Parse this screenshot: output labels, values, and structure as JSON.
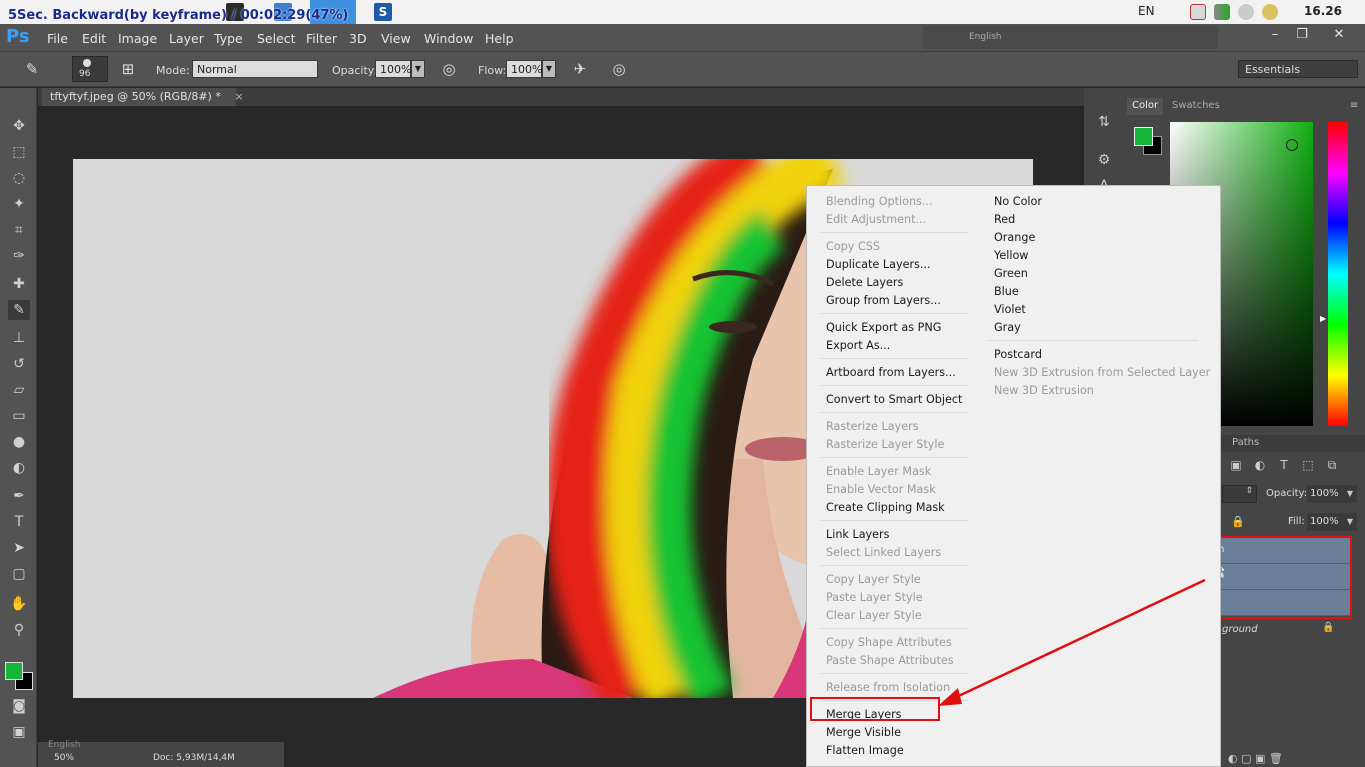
{
  "recording_overlay": "5Sec. Backward(by keyframe) / 00:02:29(47%)",
  "system_tray": {
    "language": "EN",
    "time": "16.26"
  },
  "menubar": {
    "logo": "Ps",
    "items": [
      "File",
      "Edit",
      "Image",
      "Layer",
      "Type",
      "Select",
      "Filter",
      "3D",
      "View",
      "Window",
      "Help"
    ],
    "workspace_lang": "English",
    "window_buttons": [
      "–",
      "❐",
      "✕"
    ]
  },
  "options": {
    "brush_size": "96",
    "mode_label": "Mode:",
    "mode_value": "Normal",
    "opacity_label": "Opacity:",
    "opacity_value": "100%",
    "flow_label": "Flow:",
    "flow_value": "100%",
    "workspace": "Essentials"
  },
  "document": {
    "tab_title": "tftyftyf.jpeg @ 50% (RGB/8#) *",
    "tab_close": "×",
    "zoom": "50%",
    "doc_info": "Doc: 5,93M/14,4M",
    "status_lang": "English"
  },
  "panels": {
    "color_tab": "Color",
    "swatches_tab": "Swatches",
    "paths_tab": "Paths",
    "opacity_label": "Opacity:",
    "opacity_value": "100%",
    "fill_label": "Fill:",
    "fill_value": "100%",
    "background_layer": "ground",
    "fg_color": "#16b43a",
    "bg_color": "#000000"
  },
  "layers": [
    {
      "name": "n"
    },
    {
      "name": "n"
    },
    {
      "name": ""
    }
  ],
  "context_menu": {
    "left_column": [
      {
        "label": "Blending Options...",
        "enabled": false
      },
      {
        "label": "Edit Adjustment...",
        "enabled": false
      },
      {
        "label": "Copy CSS",
        "enabled": false
      },
      {
        "label": "Duplicate Layers...",
        "enabled": true
      },
      {
        "label": "Delete Layers",
        "enabled": true
      },
      {
        "label": "Group from Layers...",
        "enabled": true
      },
      {
        "label": "Quick Export as PNG",
        "enabled": true
      },
      {
        "label": "Export As...",
        "enabled": true
      },
      {
        "label": "Artboard from Layers...",
        "enabled": true
      },
      {
        "label": "Convert to Smart Object",
        "enabled": true
      },
      {
        "label": "Rasterize Layers",
        "enabled": false
      },
      {
        "label": "Rasterize Layer Style",
        "enabled": false
      },
      {
        "label": "Enable Layer Mask",
        "enabled": false
      },
      {
        "label": "Enable Vector Mask",
        "enabled": false
      },
      {
        "label": "Create Clipping Mask",
        "enabled": true
      },
      {
        "label": "Link Layers",
        "enabled": true
      },
      {
        "label": "Select Linked Layers",
        "enabled": false
      },
      {
        "label": "Copy Layer Style",
        "enabled": false
      },
      {
        "label": "Paste Layer Style",
        "enabled": false
      },
      {
        "label": "Clear Layer Style",
        "enabled": false
      },
      {
        "label": "Copy Shape Attributes",
        "enabled": false
      },
      {
        "label": "Paste Shape Attributes",
        "enabled": false
      },
      {
        "label": "Release from Isolation",
        "enabled": false
      },
      {
        "label": "Merge Layers",
        "enabled": true
      },
      {
        "label": "Merge Visible",
        "enabled": true
      },
      {
        "label": "Flatten Image",
        "enabled": true
      }
    ],
    "right_column": [
      {
        "label": "No Color",
        "enabled": true
      },
      {
        "label": "Red",
        "enabled": true
      },
      {
        "label": "Orange",
        "enabled": true
      },
      {
        "label": "Yellow",
        "enabled": true
      },
      {
        "label": "Green",
        "enabled": true
      },
      {
        "label": "Blue",
        "enabled": true
      },
      {
        "label": "Violet",
        "enabled": true
      },
      {
        "label": "Gray",
        "enabled": true
      },
      {
        "label": "Postcard",
        "enabled": true
      },
      {
        "label": "New 3D Extrusion from Selected Layer",
        "enabled": false
      },
      {
        "label": "New 3D Extrusion",
        "enabled": false
      }
    ]
  },
  "annotation_color": "#e01010"
}
